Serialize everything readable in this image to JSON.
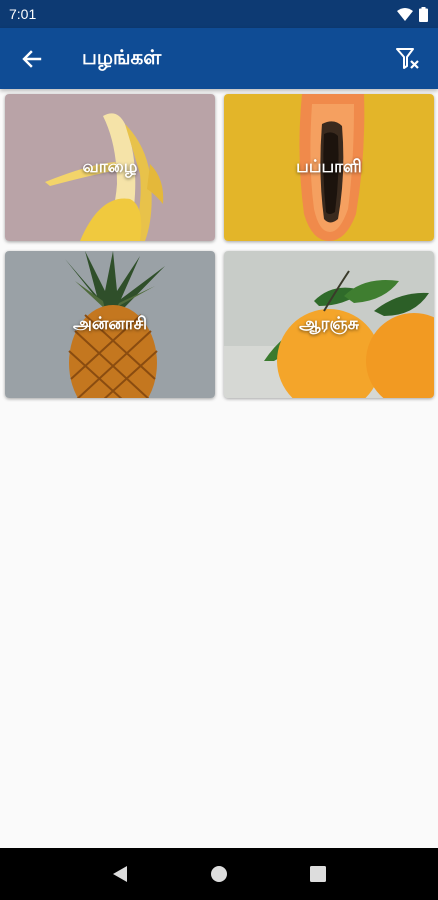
{
  "status_bar": {
    "time": "7:01",
    "icons": [
      "wifi-icon",
      "battery-icon"
    ]
  },
  "app_bar": {
    "back_icon": "arrow-left-icon",
    "title": "பழங்கள்",
    "filter_icon": "filter-clear-icon"
  },
  "fruits": [
    {
      "label": "வாழை",
      "image": "banana"
    },
    {
      "label": "பப்பாளி",
      "image": "papaya"
    },
    {
      "label": "அன்னாசி",
      "image": "pineapple"
    },
    {
      "label": "ஆரஞ்சு",
      "image": "orange"
    }
  ],
  "nav_bar": {
    "icons": [
      "back-triangle-icon",
      "home-circle-icon",
      "recents-square-icon"
    ]
  }
}
